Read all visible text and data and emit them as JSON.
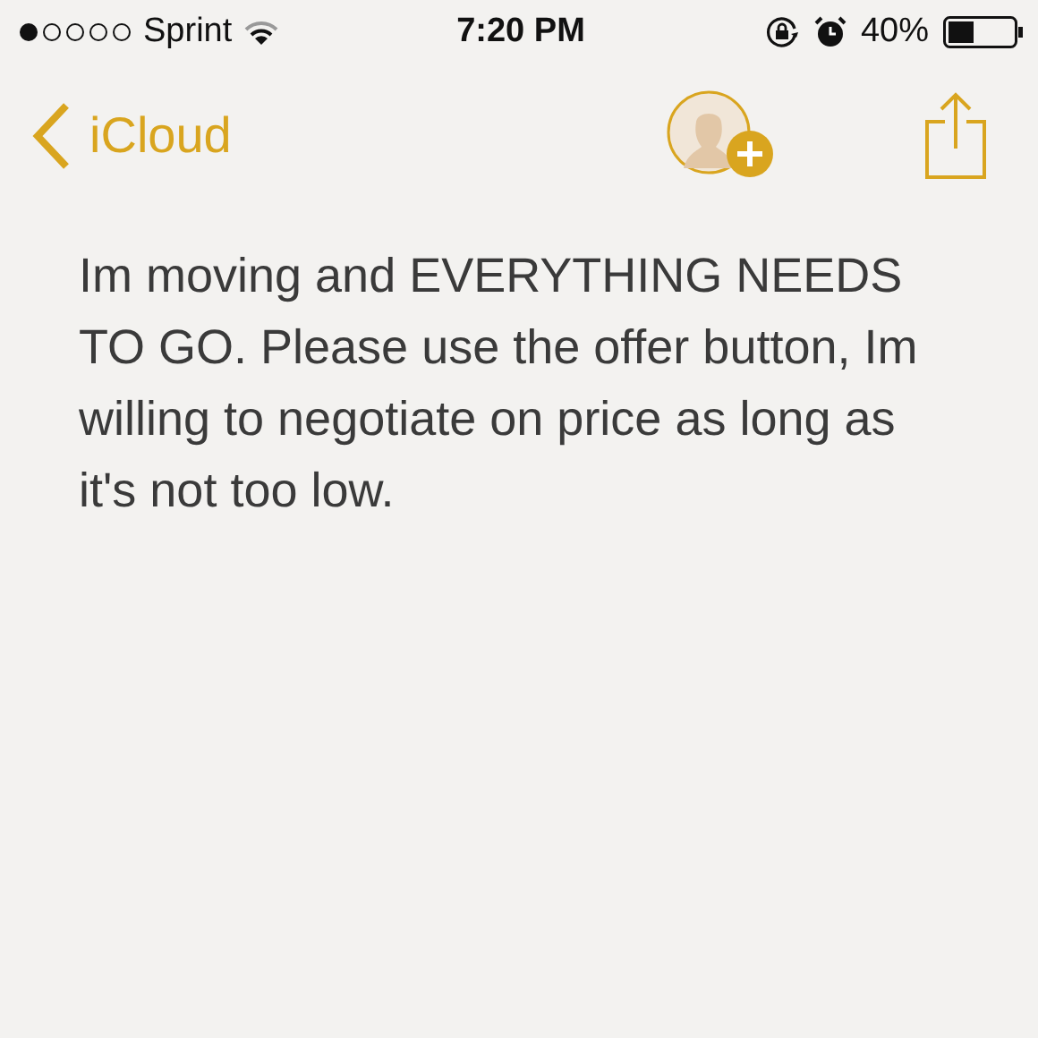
{
  "status_bar": {
    "carrier": "Sprint",
    "time": "7:20 PM",
    "battery": "40%"
  },
  "nav_bar": {
    "back_label": "iCloud"
  },
  "note": {
    "text": "Im moving and EVERYTHING NEEDS TO GO. Please use the offer button, Im willing to negotiate on price as long as it's not too low."
  }
}
